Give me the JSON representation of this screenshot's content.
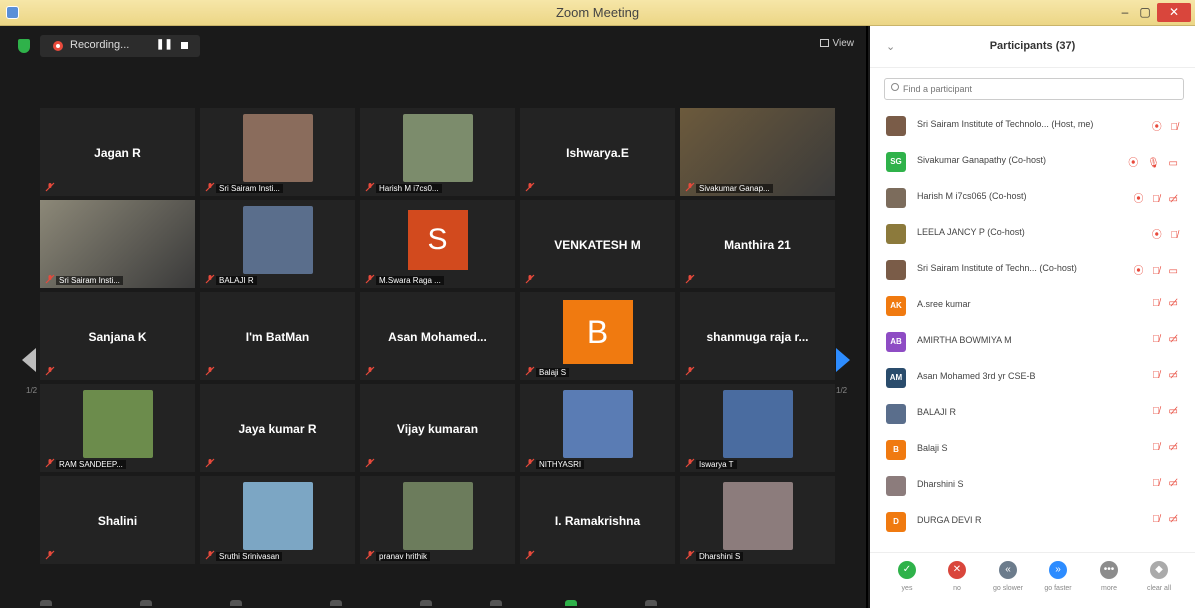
{
  "window": {
    "title": "Zoom Meeting",
    "min": "–",
    "max": "▢",
    "close": "✕"
  },
  "topbar": {
    "recording": "Recording...",
    "pause": "❚❚",
    "view": "View"
  },
  "grid": {
    "page_left": "1/2",
    "page_right": "1/2",
    "tiles": [
      {
        "type": "text",
        "name": "Jagan R"
      },
      {
        "type": "photo",
        "label": "Sri Sairam Insti...",
        "photo": "#8a6c5c"
      },
      {
        "type": "photo",
        "label": "Harish M i7cs0...",
        "photo": "#7c8c6c"
      },
      {
        "type": "text",
        "name": "Ishwarya.E"
      },
      {
        "type": "video",
        "label": "Sivakumar Ganap...",
        "photo": "#6c5a3c",
        "active": true
      },
      {
        "type": "video",
        "label": "Sri Sairam Insti...",
        "photo": "#8c8878"
      },
      {
        "type": "photo",
        "label": "BALAJI R",
        "photo": "#5a6e8c"
      },
      {
        "type": "avatar-s",
        "letter": "S",
        "label": "M.Swara Raga ..."
      },
      {
        "type": "text",
        "name": "VENKATESH M"
      },
      {
        "type": "text",
        "name": "Manthira 21"
      },
      {
        "type": "text",
        "name": "Sanjana K"
      },
      {
        "type": "text",
        "name": "I'm BatMan"
      },
      {
        "type": "text",
        "name": "Asan  Mohamed..."
      },
      {
        "type": "avatar-b",
        "letter": "B",
        "label": "Balaji S"
      },
      {
        "type": "text",
        "name": "shanmuga raja r..."
      },
      {
        "type": "photo",
        "label": "RAM SANDEEP...",
        "photo": "#6c8c4c"
      },
      {
        "type": "text",
        "name": "Jaya kumar R"
      },
      {
        "type": "text",
        "name": "Vijay kumaran"
      },
      {
        "type": "photo",
        "label": "NITHYASRI",
        "photo": "#5a7cb4"
      },
      {
        "type": "photo",
        "label": "Iswarya T",
        "photo": "#4a6ca0"
      },
      {
        "type": "text",
        "name": "Shalini"
      },
      {
        "type": "photo",
        "label": "Sruthi Srinivasan",
        "photo": "#7ca6c4"
      },
      {
        "type": "photo",
        "label": "pranav hrithik",
        "photo": "#6c7c5c"
      },
      {
        "type": "text",
        "name": "I. Ramakrishna"
      },
      {
        "type": "photo",
        "label": "Dharshini S",
        "photo": "#8c7c7c"
      }
    ]
  },
  "panel": {
    "chevron": "⌄",
    "title": "Participants (37)",
    "search_placeholder": "Find a participant",
    "participants": [
      {
        "name": "Sri Sairam Institute of Technolo...  (Host, me)",
        "avatar": "",
        "color": "#7a5c48",
        "icons": "⦿ 🎙̸"
      },
      {
        "name": "Sivakumar Ganapathy (Co-host)",
        "avatar": "SG",
        "color": "#2fb24a",
        "icons": "⦿ 🎙 ▭"
      },
      {
        "name": "Harish M i7cs065 (Co-host)",
        "avatar": "",
        "color": "#7c6c5c",
        "icons": "⦿ 🎙̸ ▭̸"
      },
      {
        "name": "LEELA JANCY P (Co-host)",
        "avatar": "",
        "color": "#8c7a3c",
        "icons": "⦿ 🎙̸"
      },
      {
        "name": "Sri Sairam Institute of Techn...  (Co-host)",
        "avatar": "",
        "color": "#7a5c48",
        "icons": "⦿ 🎙̸ ▭"
      },
      {
        "name": "A.sree kumar",
        "avatar": "AK",
        "color": "#f07a10",
        "icons": "🎙̸ ▭̸"
      },
      {
        "name": "AMIRTHA BOWMIYA M",
        "avatar": "AB",
        "color": "#8e4cc4",
        "icons": "🎙̸ ▭̸"
      },
      {
        "name": "Asan Mohamed 3rd yr CSE-B",
        "avatar": "AM",
        "color": "#2a4c6c",
        "icons": "🎙̸ ▭̸"
      },
      {
        "name": "BALAJI R",
        "avatar": "",
        "color": "#5a6e8c",
        "icons": "🎙̸ ▭̸"
      },
      {
        "name": "Balaji S",
        "avatar": "B",
        "color": "#f07a10",
        "icons": "🎙̸ ▭̸"
      },
      {
        "name": "Dharshini S",
        "avatar": "",
        "color": "#8c7c7c",
        "icons": "🎙̸ ▭̸"
      },
      {
        "name": "DURGA DEVI R",
        "avatar": "D",
        "color": "#f07a10",
        "icons": "🎙̸ ▭̸"
      }
    ],
    "reactions": [
      {
        "label": "yes",
        "glyph": "✓",
        "color": "#2fb24a"
      },
      {
        "label": "no",
        "glyph": "✕",
        "color": "#d9463c"
      },
      {
        "label": "go slower",
        "glyph": "«",
        "color": "#6c7c8c"
      },
      {
        "label": "go faster",
        "glyph": "»",
        "color": "#2d8cff"
      },
      {
        "label": "more",
        "glyph": "•••",
        "color": "#8c8c8c"
      },
      {
        "label": "clear all",
        "glyph": "◆",
        "color": "#aaa"
      }
    ]
  }
}
